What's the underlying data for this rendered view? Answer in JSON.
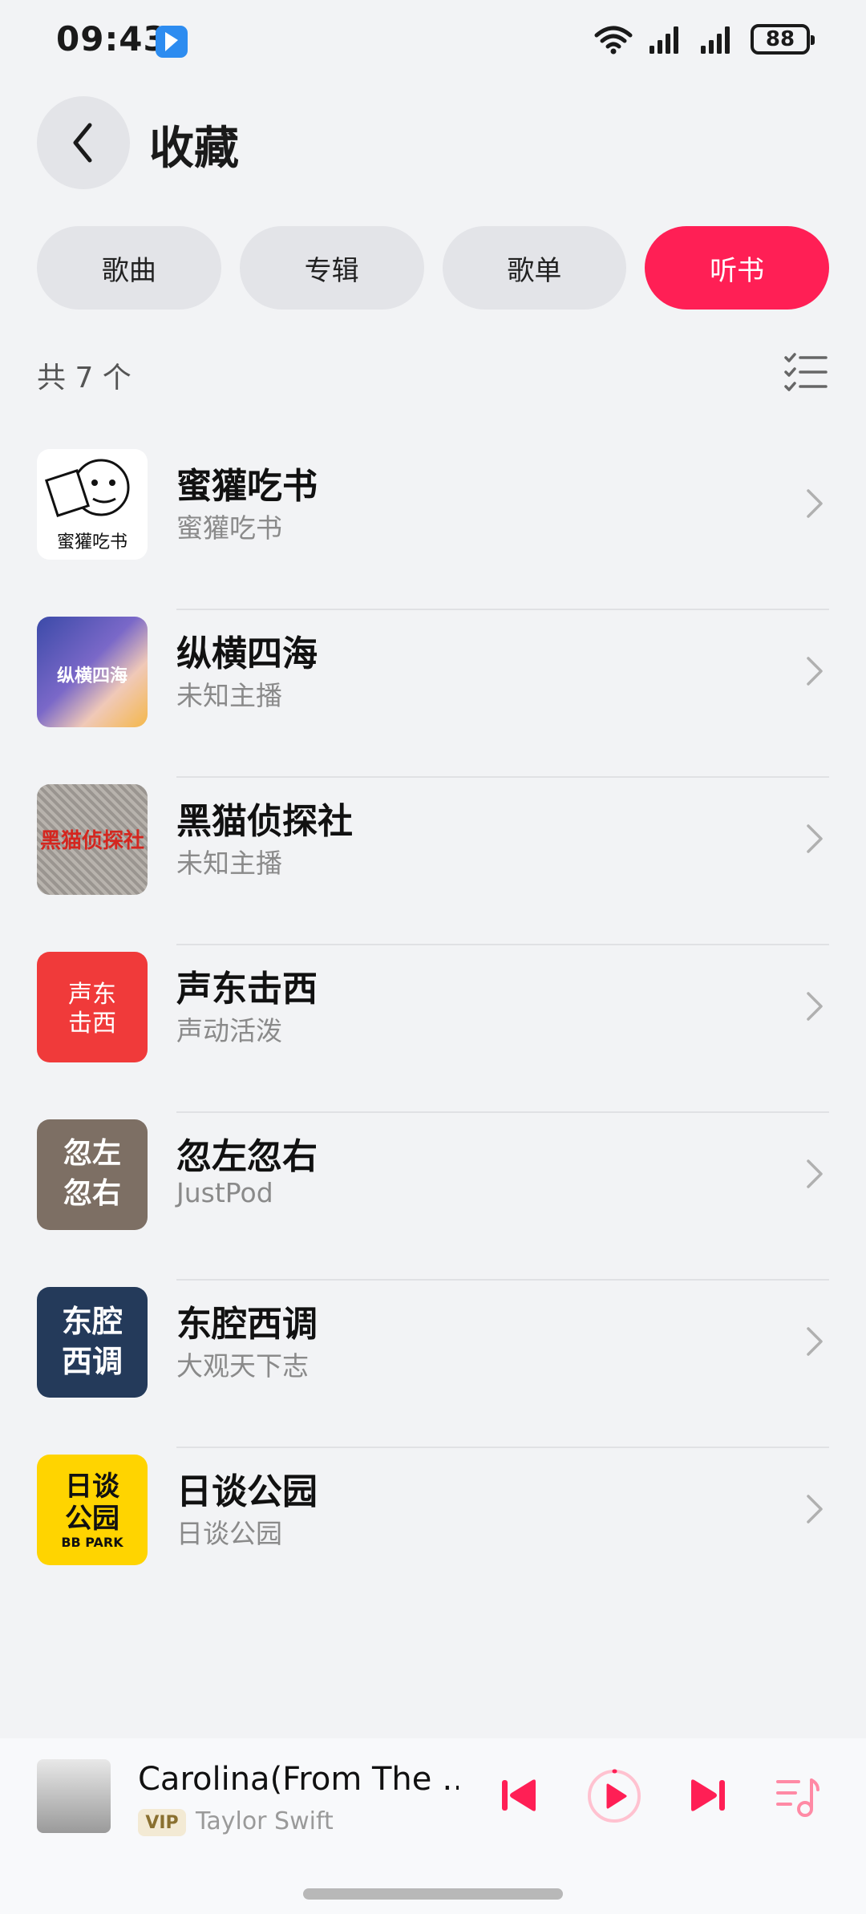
{
  "status": {
    "time": "09:43",
    "battery": "88"
  },
  "header": {
    "title": "收藏"
  },
  "tabs": [
    {
      "label": "歌曲",
      "active": false
    },
    {
      "label": "专辑",
      "active": false
    },
    {
      "label": "歌单",
      "active": false
    },
    {
      "label": "听书",
      "active": true
    }
  ],
  "count_label": "共 7 个",
  "items": [
    {
      "title": "蜜獾吃书",
      "subtitle": "蜜獾吃书",
      "cover_text": "蜜獾吃书"
    },
    {
      "title": "纵横四海",
      "subtitle": "未知主播",
      "cover_text": "纵横四海"
    },
    {
      "title": "黑猫侦探社",
      "subtitle": "未知主播",
      "cover_text": "黑猫侦探社"
    },
    {
      "title": "声东击西",
      "subtitle": "声动活泼",
      "cover_text": "声东击西"
    },
    {
      "title": "忽左忽右",
      "subtitle": "JustPod",
      "cover_text": "忽左忽右"
    },
    {
      "title": "东腔西调",
      "subtitle": "大观天下志",
      "cover_text": "东腔西调"
    },
    {
      "title": "日谈公园",
      "subtitle": "日谈公园",
      "cover_text": "日谈公园",
      "cover_sub": "BB PARK"
    }
  ],
  "player": {
    "title": "Carolina(From The …",
    "vip": "VIP",
    "artist": "Taylor Swift"
  },
  "colors": {
    "accent": "#ff1f55",
    "player_icon": "#ff1f55"
  }
}
